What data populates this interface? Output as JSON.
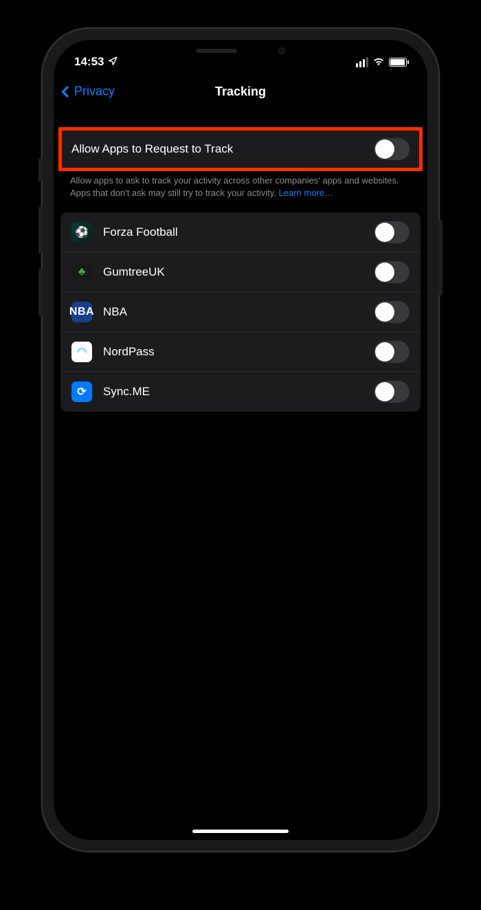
{
  "status": {
    "time": "14:53",
    "location_icon": "location-arrow"
  },
  "nav": {
    "back_label": "Privacy",
    "title": "Tracking"
  },
  "main_toggle": {
    "label": "Allow Apps to Request to Track",
    "enabled": false
  },
  "footer": {
    "text": "Allow apps to ask to track your activity across other companies' apps and websites. Apps that don't ask may still try to track your activity. ",
    "link": "Learn more…"
  },
  "apps": [
    {
      "name": "Forza Football",
      "icon": "⚽",
      "icon_class": "ic-forza",
      "enabled": false
    },
    {
      "name": "GumtreeUK",
      "icon": "♣",
      "icon_class": "ic-gum",
      "enabled": false,
      "icon_color": "#3cb043"
    },
    {
      "name": "NBA",
      "icon": "NBA",
      "icon_class": "ic-nba",
      "enabled": false
    },
    {
      "name": "NordPass",
      "icon": "◠",
      "icon_class": "ic-nord",
      "enabled": false,
      "icon_color": "#4fc3f7"
    },
    {
      "name": "Sync.ME",
      "icon": "⟳",
      "icon_class": "ic-sync",
      "enabled": false
    }
  ]
}
